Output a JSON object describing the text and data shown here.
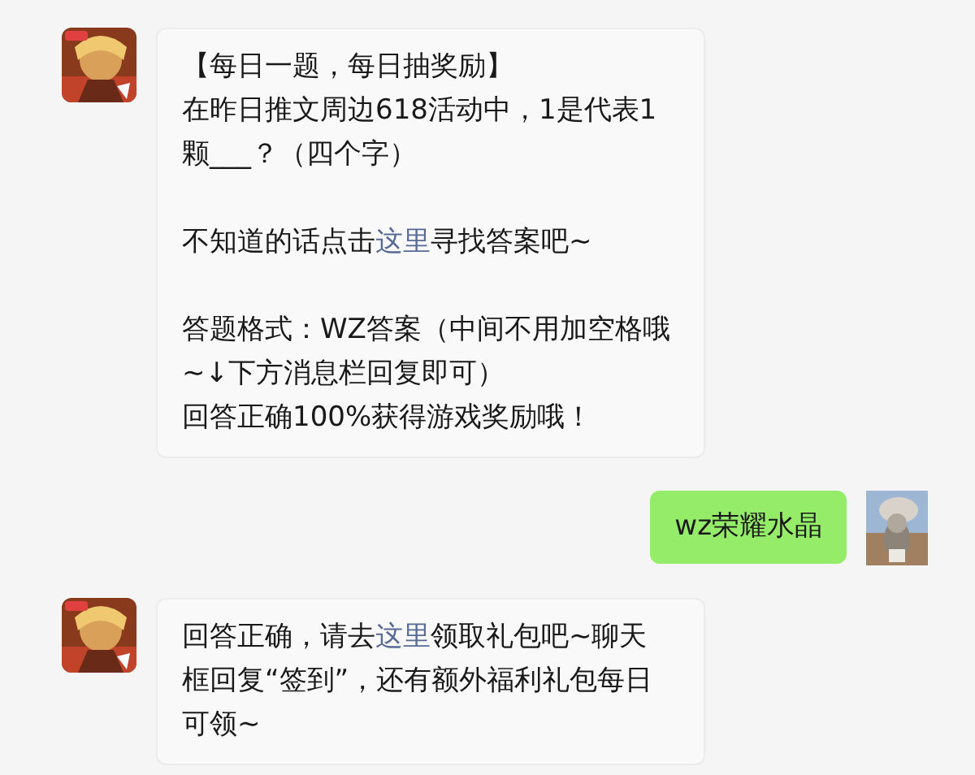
{
  "messages": [
    {
      "kind": "received",
      "paragraphs": [
        [
          [
            {
              "kind": "text",
              "text": "【每日一题，每日抽奖励】"
            }
          ],
          [
            {
              "kind": "text",
              "text": "在昨日推文周边618活动中，1是代表1颗___？（四个字）"
            }
          ]
        ],
        [
          [
            {
              "kind": "text",
              "text": "不知道的话点击"
            },
            {
              "kind": "link",
              "text": "这里"
            },
            {
              "kind": "text",
              "text": "寻找答案吧~"
            }
          ]
        ],
        [
          [
            {
              "kind": "text",
              "text": "答题格式：WZ答案（中间不用加空格哦~↓下方消息栏回复即可）"
            }
          ],
          [
            {
              "kind": "text",
              "text": "回答正确100%获得游戏奖励哦！"
            }
          ]
        ]
      ]
    },
    {
      "kind": "sent",
      "paragraphs": [
        [
          [
            {
              "kind": "text",
              "text": "wz荣耀水晶"
            }
          ]
        ]
      ]
    },
    {
      "kind": "received",
      "paragraphs": [
        [
          [
            {
              "kind": "text",
              "text": "回答正确，请去"
            },
            {
              "kind": "link",
              "text": "这里"
            },
            {
              "kind": "text",
              "text": "领取礼包吧~聊天框回复“签到”，还有额外福利礼包每日可领~"
            }
          ]
        ]
      ]
    }
  ]
}
